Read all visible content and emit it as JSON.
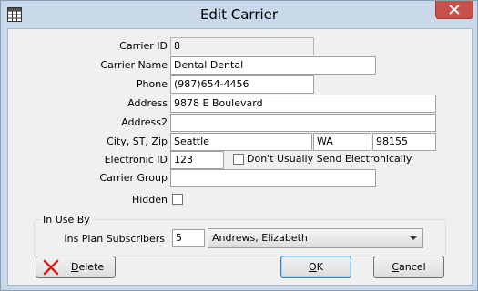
{
  "window": {
    "title": "Edit Carrier"
  },
  "icons": {
    "app": "grid-icon",
    "close": "close-icon",
    "delete": "red-x-icon",
    "dropdown": "chevron-down-icon"
  },
  "colors": {
    "frame": "#c9d9ea",
    "close_button": "#c7504a",
    "delete_icon": "#d42020"
  },
  "form": {
    "carrier_id": {
      "label": "Carrier ID",
      "value": "8"
    },
    "carrier_name": {
      "label": "Carrier Name",
      "value": "Dental Dental"
    },
    "phone": {
      "label": "Phone",
      "value": "(987)654-4456"
    },
    "address": {
      "label": "Address",
      "value": "9878 E Boulevard"
    },
    "address2": {
      "label": "Address2",
      "value": ""
    },
    "city_st_zip": {
      "label": "City, ST, Zip",
      "city": "Seattle",
      "state": "WA",
      "zip": "98155"
    },
    "electronic_id": {
      "label": "Electronic ID",
      "value": "123"
    },
    "dont_send_electronically": {
      "label": "Don't Usually Send Electronically",
      "checked": false
    },
    "carrier_group": {
      "label": "Carrier Group",
      "value": ""
    },
    "hidden": {
      "label": "Hidden",
      "checked": false
    }
  },
  "in_use_by": {
    "title": "In Use By",
    "ins_plan_subscribers": {
      "label": "Ins Plan Subscribers",
      "count": "5",
      "selected": "Andrews, Elizabeth"
    }
  },
  "buttons": {
    "delete": {
      "accel": "D",
      "rest": "elete"
    },
    "ok": {
      "accel": "O",
      "rest": "K"
    },
    "cancel": {
      "accel": "C",
      "rest": "ancel"
    }
  }
}
